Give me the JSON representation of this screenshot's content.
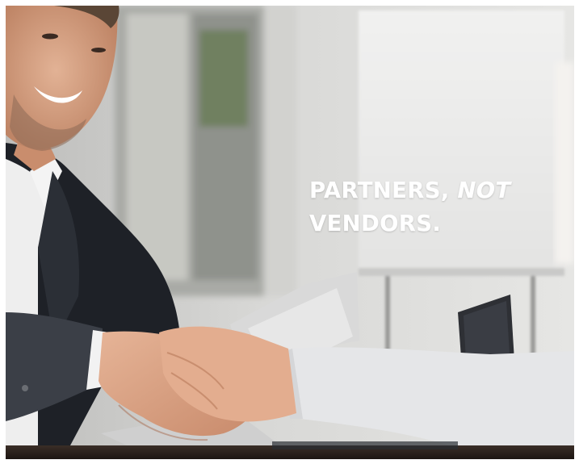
{
  "headline": {
    "line1_plain": "PARTNERS, ",
    "line1_emphasis": "NOT",
    "line2": "VENDORS."
  },
  "photo": {
    "subject": "business-handshake",
    "colors": {
      "wall": "#dcdcda",
      "suit": "#1f2228",
      "sleeve": "#e4e4e6",
      "skin": "#d9a586",
      "table": "#2a211c",
      "text": "#ffffff"
    }
  }
}
